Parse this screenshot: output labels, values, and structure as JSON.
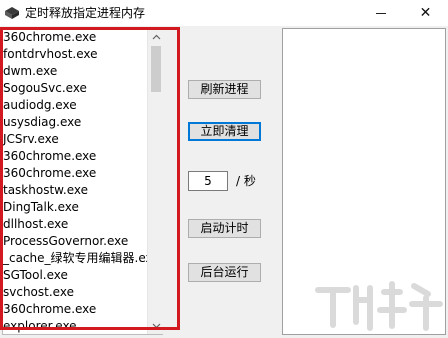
{
  "window": {
    "title": "定时释放指定进程内存"
  },
  "process_list": {
    "items": [
      "360chrome.exe",
      "fontdrvhost.exe",
      "dwm.exe",
      "SogouSvc.exe",
      "audiodg.exe",
      "usysdiag.exe",
      "JCSrv.exe",
      "360chrome.exe",
      "360chrome.exe",
      "taskhostw.exe",
      "DingTalk.exe",
      "dllhost.exe",
      "ProcessGovernor.exe",
      "_cache_绿软专用编辑器.exe",
      "SGTool.exe",
      "svchost.exe",
      "360chrome.exe",
      "explorer.exe"
    ]
  },
  "controls": {
    "refresh_label": "刷新进程",
    "clear_label": "立即清理",
    "interval_value": "5",
    "interval_unit": "/ 秒",
    "timer_label": "启动计时",
    "background_label": "后台运行"
  },
  "colors": {
    "highlight_frame": "#d2191f",
    "focus_border": "#0078d7"
  }
}
